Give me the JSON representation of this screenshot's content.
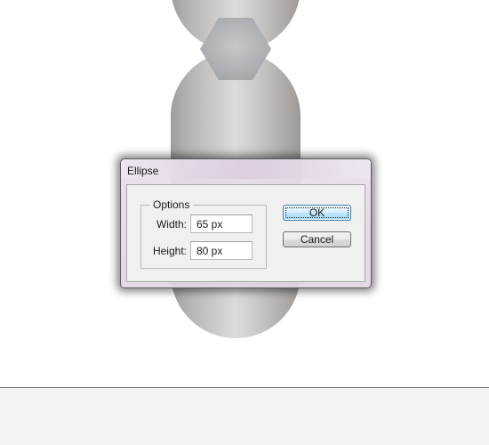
{
  "dialog": {
    "title": "Ellipse",
    "options_group_label": "Options",
    "width_label": "Width:",
    "width_value": "65 px",
    "height_label": "Height:",
    "height_value": "80 px",
    "ok_label": "OK",
    "cancel_label": "Cancel"
  },
  "artboard": {
    "shape_gradient_colors": [
      "#9f9c9b",
      "#dcdcdc",
      "#9c9997"
    ],
    "hexagon_colors": [
      "#a4a5a8",
      "#c6c7ca"
    ],
    "background": "#ffffff"
  },
  "bottom_panel": {
    "background": "#f3f3f3"
  }
}
